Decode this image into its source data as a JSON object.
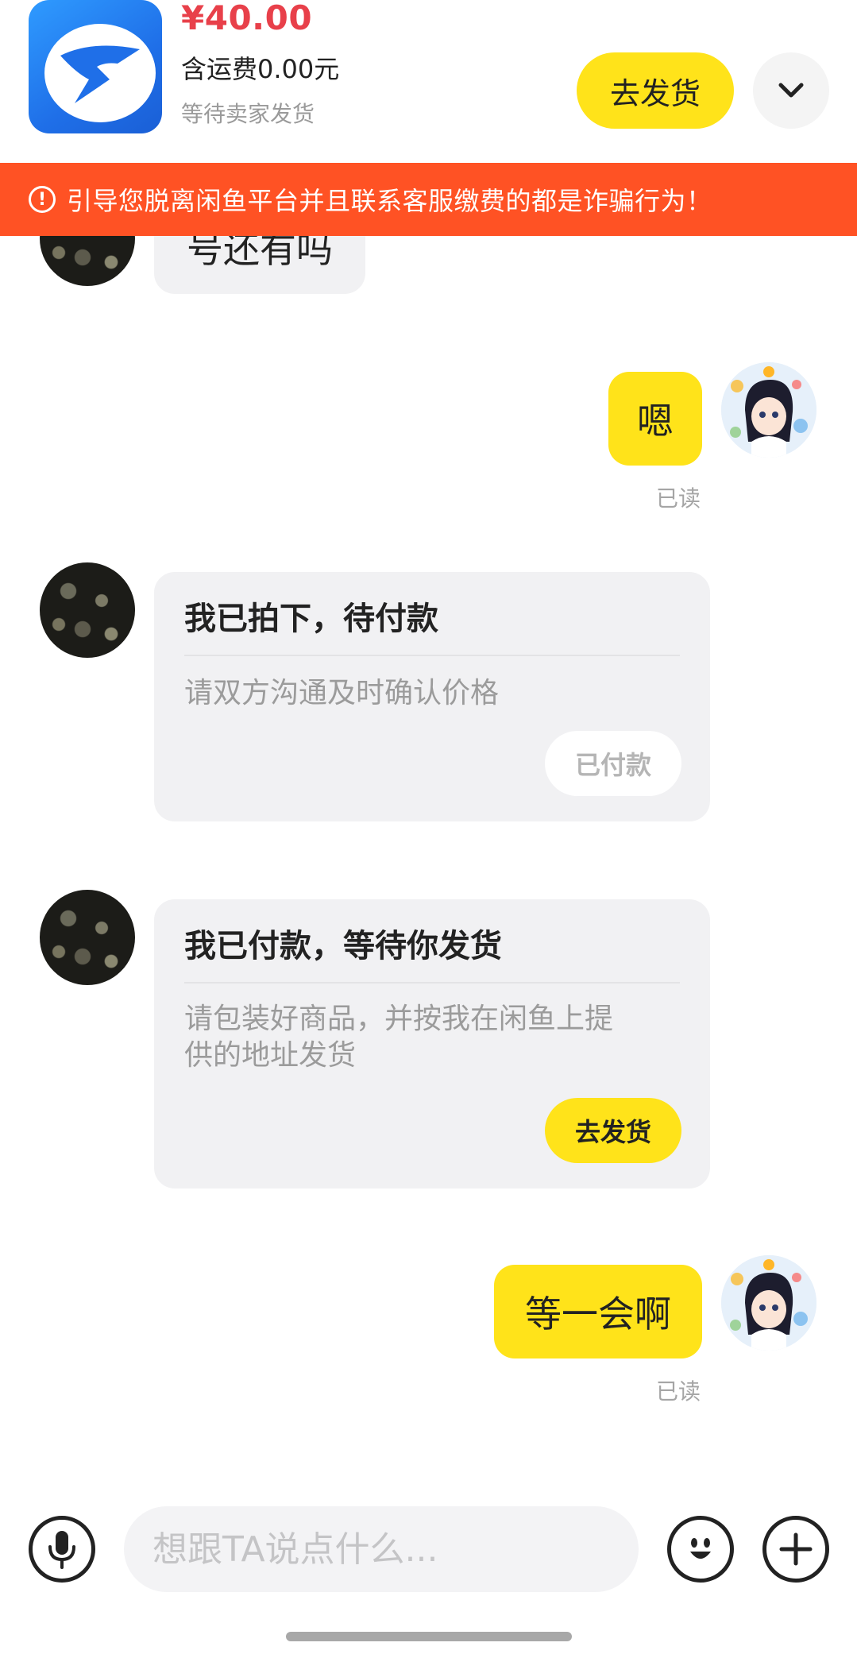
{
  "header": {
    "price": "¥40.00",
    "shipping": "含运费0.00元",
    "status": "等待卖家发货",
    "ship_button": "去发货"
  },
  "warning": {
    "icon": "!",
    "text": "引导您脱离闲鱼平台并且联系客服缴费的都是诈骗行为！"
  },
  "messages": {
    "partial_text": "号还有吗",
    "reply_1": "嗯",
    "read_1": "已读",
    "card_1": {
      "title": "我已拍下，待付款",
      "subtitle": "请双方沟通及时确认价格",
      "button": "已付款"
    },
    "card_2": {
      "title": "我已付款，等待你发货",
      "subtitle_line1": "请包装好商品，并按我在闲鱼上提",
      "subtitle_line2": "供的地址发货",
      "button": "去发货"
    },
    "reply_2": "等一会啊",
    "read_2": "已读"
  },
  "input": {
    "placeholder": "想跟TA说点什么..."
  },
  "colors": {
    "accent_yellow": "#ffe31a",
    "warning_orange": "#ff5224",
    "price_red": "#e8404a"
  },
  "icons": [
    "app-logo-icon",
    "chevron-down-icon",
    "warning-icon",
    "microphone-icon",
    "emoji-icon",
    "plus-icon"
  ]
}
